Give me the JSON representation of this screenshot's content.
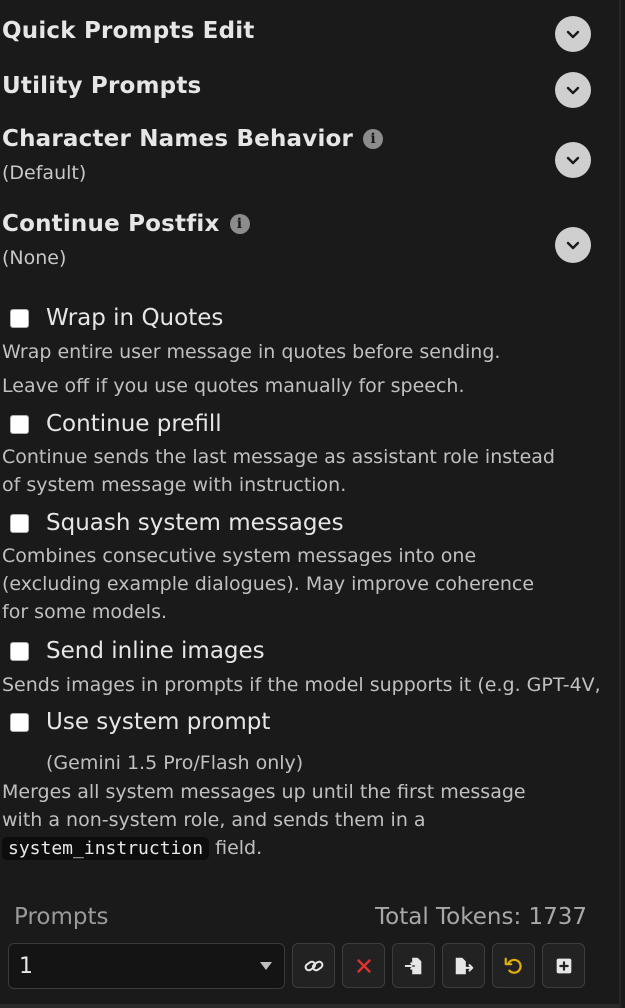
{
  "sections": [
    {
      "title": "Quick Prompts Edit"
    },
    {
      "title": "Utility Prompts"
    },
    {
      "title": "Character Names Behavior",
      "value": "(Default)"
    },
    {
      "title": "Continue Postfix",
      "value": "(None)"
    }
  ],
  "options": {
    "wrap_quotes": {
      "label": "Wrap in Quotes",
      "desc1": "Wrap entire user message in quotes before sending.",
      "desc2": "Leave off if you use quotes manually for speech."
    },
    "continue_prefill": {
      "label": "Continue prefill",
      "desc1": "Continue sends the last message as assistant role instead",
      "desc2": "of system message with instruction."
    },
    "squash": {
      "label": "Squash system messages",
      "desc1": "Combines consecutive system messages into one",
      "desc2": "(excluding example dialogues). May improve coherence",
      "desc3": "for some models."
    },
    "inline_images": {
      "label": "Send inline images",
      "desc1": "Sends images in prompts if the model supports it (e.g. GPT-4V,"
    },
    "system_prompt": {
      "label": "Use system prompt",
      "note": "(Gemini 1.5 Pro/Flash only)",
      "desc1": "Merges all system messages up until the first message",
      "desc2": "with a non-system role, and sends them in a",
      "code": "system_instruction",
      "desc3_tail": " field."
    }
  },
  "prompts": {
    "label": "Prompts",
    "total_tokens": "Total Tokens: 1737",
    "selected": "1"
  },
  "toolbar_icons": [
    "link-icon",
    "close-icon",
    "import-icon",
    "export-icon",
    "reset-icon",
    "add-icon"
  ],
  "colors": {
    "background": "#1a1a1a",
    "delete": "#e03030",
    "reset": "#e0b000",
    "chevron_bg": "#cfcfcf"
  }
}
